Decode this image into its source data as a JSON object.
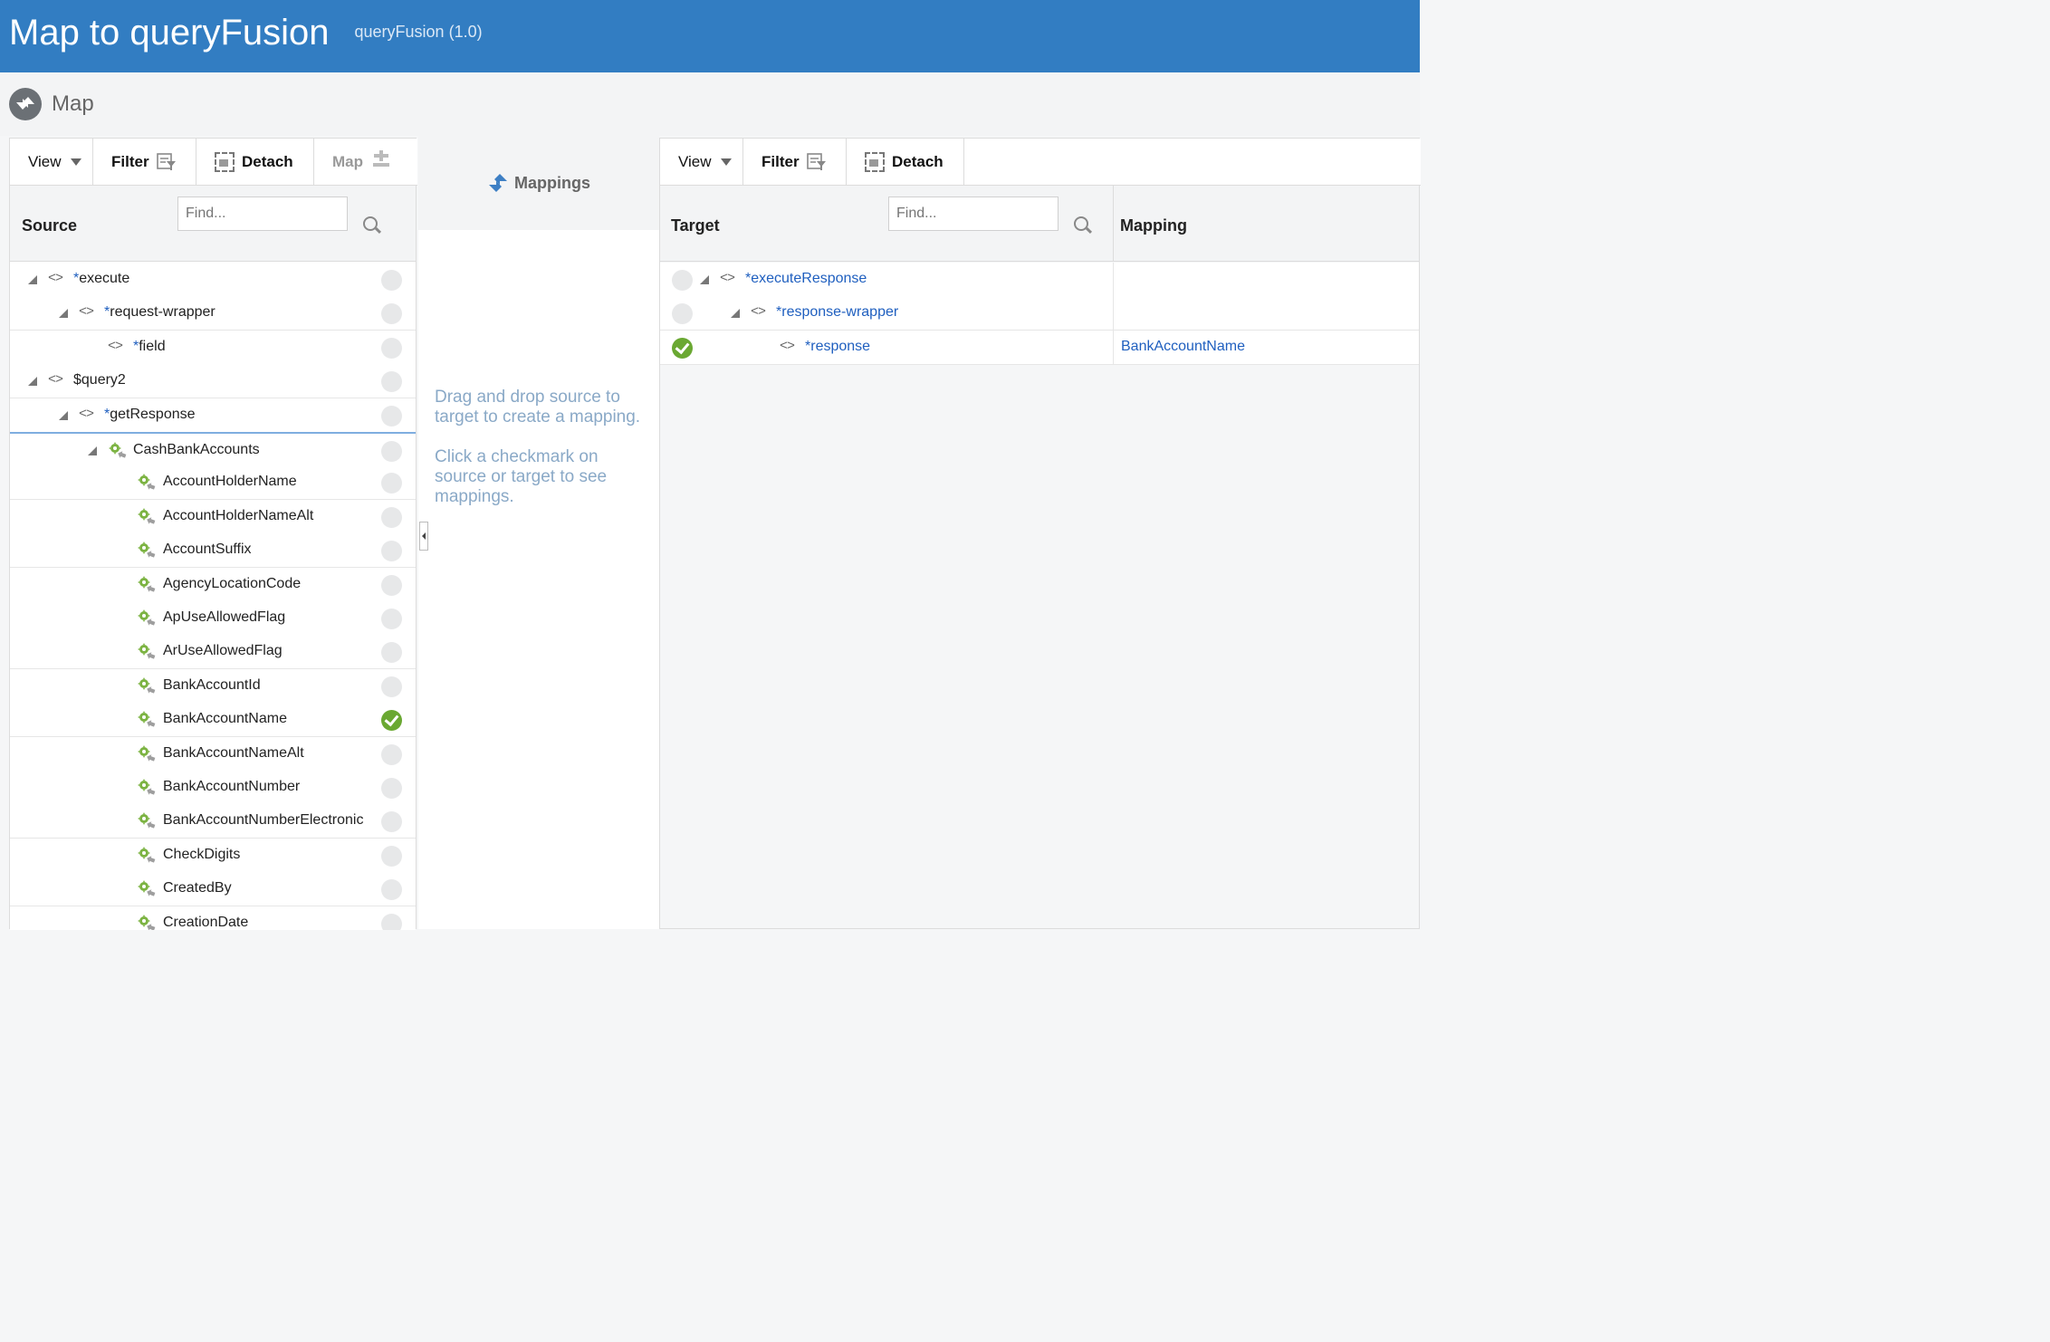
{
  "header": {
    "title": "Map to queryFusion",
    "subtitle": "queryFusion (1.0)"
  },
  "mapbar": {
    "label": "Map"
  },
  "source_panel": {
    "toolbar": {
      "view": "View",
      "filter": "Filter",
      "detach": "Detach",
      "map": "Map"
    },
    "heading": "Source",
    "find_placeholder": "Find...",
    "rows": [
      {
        "label": "execute",
        "required": true,
        "status": "none"
      },
      {
        "label": "request-wrapper",
        "required": true,
        "status": "none"
      },
      {
        "label": "field",
        "required": true,
        "status": "none"
      },
      {
        "label": "$query2",
        "required": false,
        "status": "none"
      },
      {
        "label": "getResponse",
        "required": true,
        "status": "none"
      },
      {
        "label": "CashBankAccounts",
        "required": false,
        "status": "none"
      },
      {
        "label": "AccountHolderName",
        "required": false,
        "status": "none"
      },
      {
        "label": "AccountHolderNameAlt",
        "required": false,
        "status": "none"
      },
      {
        "label": "AccountSuffix",
        "required": false,
        "status": "none"
      },
      {
        "label": "AgencyLocationCode",
        "required": false,
        "status": "none"
      },
      {
        "label": "ApUseAllowedFlag",
        "required": false,
        "status": "none"
      },
      {
        "label": "ArUseAllowedFlag",
        "required": false,
        "status": "none"
      },
      {
        "label": "BankAccountId",
        "required": false,
        "status": "none"
      },
      {
        "label": "BankAccountName",
        "required": false,
        "status": "mapped"
      },
      {
        "label": "BankAccountNameAlt",
        "required": false,
        "status": "none"
      },
      {
        "label": "BankAccountNumber",
        "required": false,
        "status": "none"
      },
      {
        "label": "BankAccountNumberElectronic",
        "required": false,
        "status": "none"
      },
      {
        "label": "CheckDigits",
        "required": false,
        "status": "none"
      },
      {
        "label": "CreatedBy",
        "required": false,
        "status": "none"
      },
      {
        "label": "CreationDate",
        "required": false,
        "status": "none"
      }
    ]
  },
  "mappings_panel": {
    "heading": "Mappings",
    "hint1": "Drag and drop source to target to create a mapping.",
    "hint2": "Click a checkmark on source or target to see mappings."
  },
  "target_panel": {
    "toolbar": {
      "view": "View",
      "filter": "Filter",
      "detach": "Detach"
    },
    "heading": "Target",
    "mapping_heading": "Mapping",
    "find_placeholder": "Find...",
    "rows": [
      {
        "label": "executeResponse",
        "required": true,
        "status": "none",
        "mapping": ""
      },
      {
        "label": "response-wrapper",
        "required": true,
        "status": "none",
        "mapping": ""
      },
      {
        "label": "response",
        "required": true,
        "status": "mapped",
        "mapping": "BankAccountName"
      }
    ]
  },
  "colors": {
    "header_bg": "#327dc2",
    "mapped_check": "#6aa832",
    "link_blue": "#1f5fbf"
  }
}
